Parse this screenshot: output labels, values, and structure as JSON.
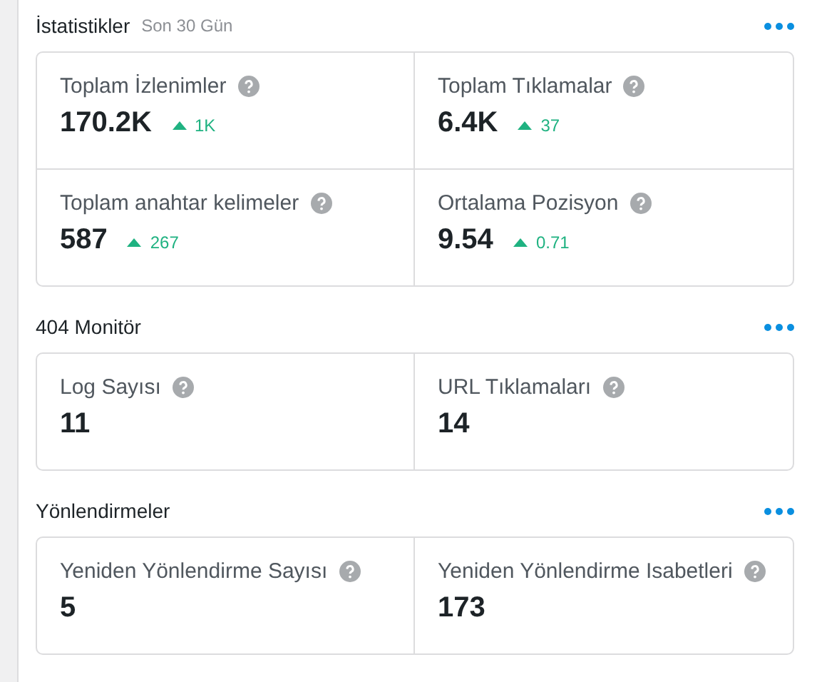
{
  "sections": [
    {
      "title": "İstatistikler",
      "subtitle": "Son 30 Gün",
      "metrics": [
        {
          "label": "Toplam İzlenimler",
          "value": "170.2K",
          "change": "1K",
          "kind": "rise"
        },
        {
          "label": "Toplam Tıklamalar",
          "value": "6.4K",
          "change": "37",
          "kind": "rise"
        },
        {
          "label": "Toplam anahtar kelimeler",
          "value": "587",
          "change": "267",
          "kind": "rise"
        },
        {
          "label": "Ortalama Pozisyon",
          "value": "9.54",
          "change": "0.71",
          "kind": "rise"
        }
      ]
    },
    {
      "title": "404 Monitör",
      "metrics": [
        {
          "label": "Log Sayısı",
          "value": "11"
        },
        {
          "label": "URL Tıklamaları",
          "value": "14"
        }
      ]
    },
    {
      "title": "Yönlendirmeler",
      "metrics": [
        {
          "label": "Yeniden Yönlendirme Sayısı",
          "value": "5"
        },
        {
          "label": "Yeniden Yönlendirme Isabetleri",
          "value": "173"
        }
      ]
    }
  ]
}
